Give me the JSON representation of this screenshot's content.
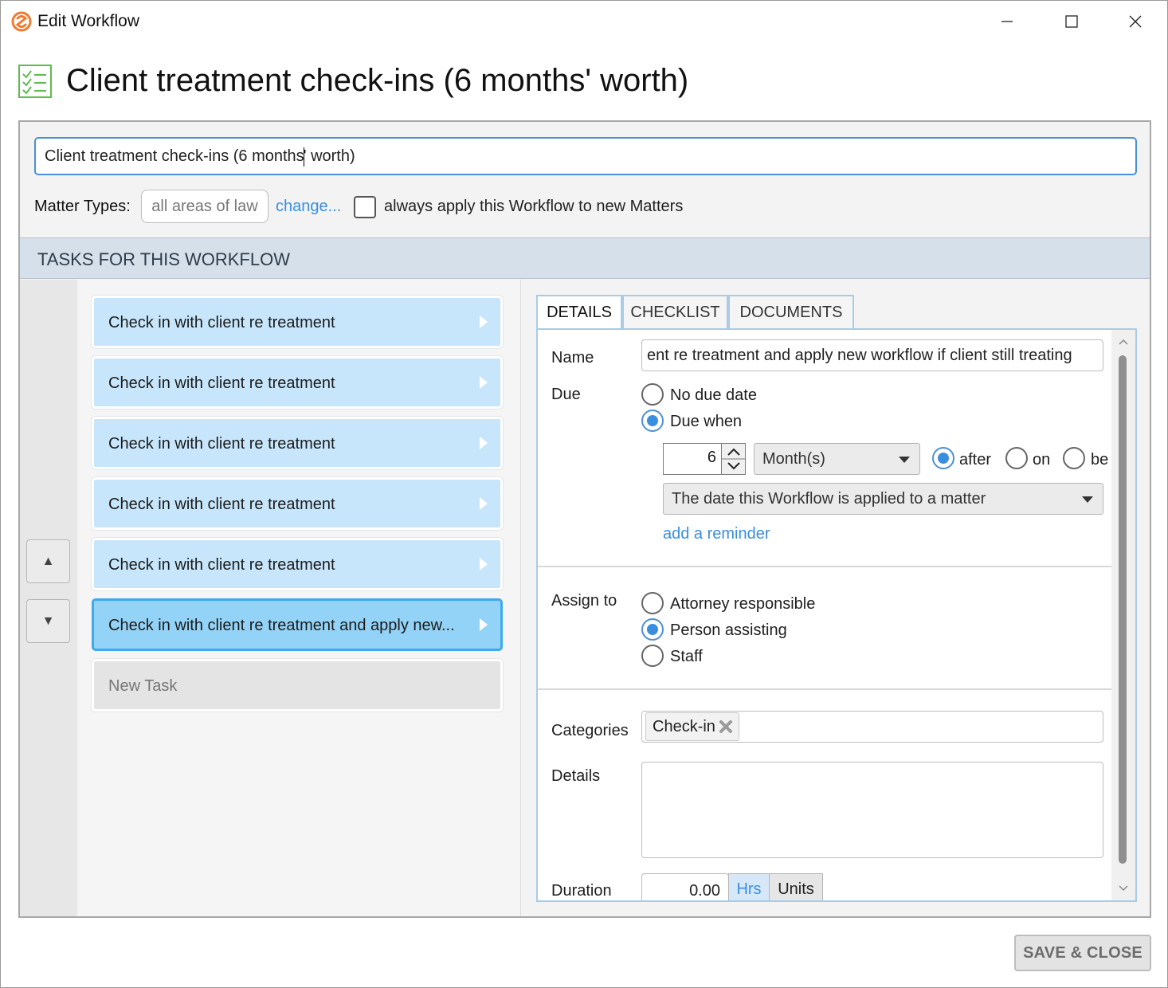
{
  "window": {
    "title": "Edit Workflow",
    "controls": [
      "minimize-icon",
      "maximize-icon",
      "close-icon"
    ]
  },
  "header": {
    "title": "Client treatment check-ins (6 months' worth)",
    "icon": "checklist-icon"
  },
  "workflow": {
    "name_before_caret": "Client treatment check-ins (6 months",
    "name_after_caret": "' worth)",
    "matter_types_label": "Matter Types:",
    "matter_types_value": "all areas of law",
    "change_link": "change...",
    "always_apply_checked": false,
    "always_apply_label": "always apply this Workflow to new Matters"
  },
  "tasks_header": "TASKS FOR THIS WORKFLOW",
  "move_buttons": {
    "up": "▲",
    "down": "▼"
  },
  "tasks": [
    {
      "label": "Check in with client re treatment",
      "selected": false
    },
    {
      "label": "Check in with client re treatment",
      "selected": false
    },
    {
      "label": "Check in with client re treatment",
      "selected": false
    },
    {
      "label": "Check in with client re treatment",
      "selected": false
    },
    {
      "label": "Check in with client re treatment",
      "selected": false
    },
    {
      "label": "Check in with client re treatment and apply new...",
      "selected": true
    }
  ],
  "new_task_label": "New Task",
  "tabs": [
    {
      "label": "DETAILS",
      "active": true
    },
    {
      "label": "CHECKLIST",
      "active": false
    },
    {
      "label": "DOCUMENTS",
      "active": false
    }
  ],
  "details": {
    "name_label": "Name",
    "name_value": "ent re treatment and apply new workflow if client still treating",
    "due_label": "Due",
    "due_options": [
      {
        "label": "No due date",
        "selected": false
      },
      {
        "label": "Due when",
        "selected": true
      }
    ],
    "due_amount": "6",
    "due_unit": "Month(s)",
    "relation_options": [
      {
        "label": "after",
        "selected": true
      },
      {
        "label": "on",
        "selected": false
      },
      {
        "label": "be",
        "selected": false
      }
    ],
    "anchor_event": "The date this Workflow is applied to a matter",
    "add_reminder": "add a reminder",
    "assign_label": "Assign to",
    "assign_options": [
      {
        "label": "Attorney responsible",
        "selected": false
      },
      {
        "label": "Person assisting",
        "selected": true
      },
      {
        "label": "Staff",
        "selected": false
      }
    ],
    "categories_label": "Categories",
    "categories": [
      "Check-in"
    ],
    "details_label": "Details",
    "details_value": "",
    "duration_label": "Duration",
    "duration_value": "0.00",
    "duration_units": [
      {
        "label": "Hrs",
        "active": true
      },
      {
        "label": "Units",
        "active": false
      }
    ]
  },
  "save_button": "SAVE & CLOSE",
  "colors": {
    "accent": "#3a8ee0",
    "task_bg": "#c7e6fb",
    "task_selected_bg": "#93d3f7",
    "task_selected_border": "#3ea9ec",
    "tasks_bar_bg": "#d6e0ea",
    "icon_green": "#5cbf4c",
    "logo_orange": "#f07a32"
  }
}
